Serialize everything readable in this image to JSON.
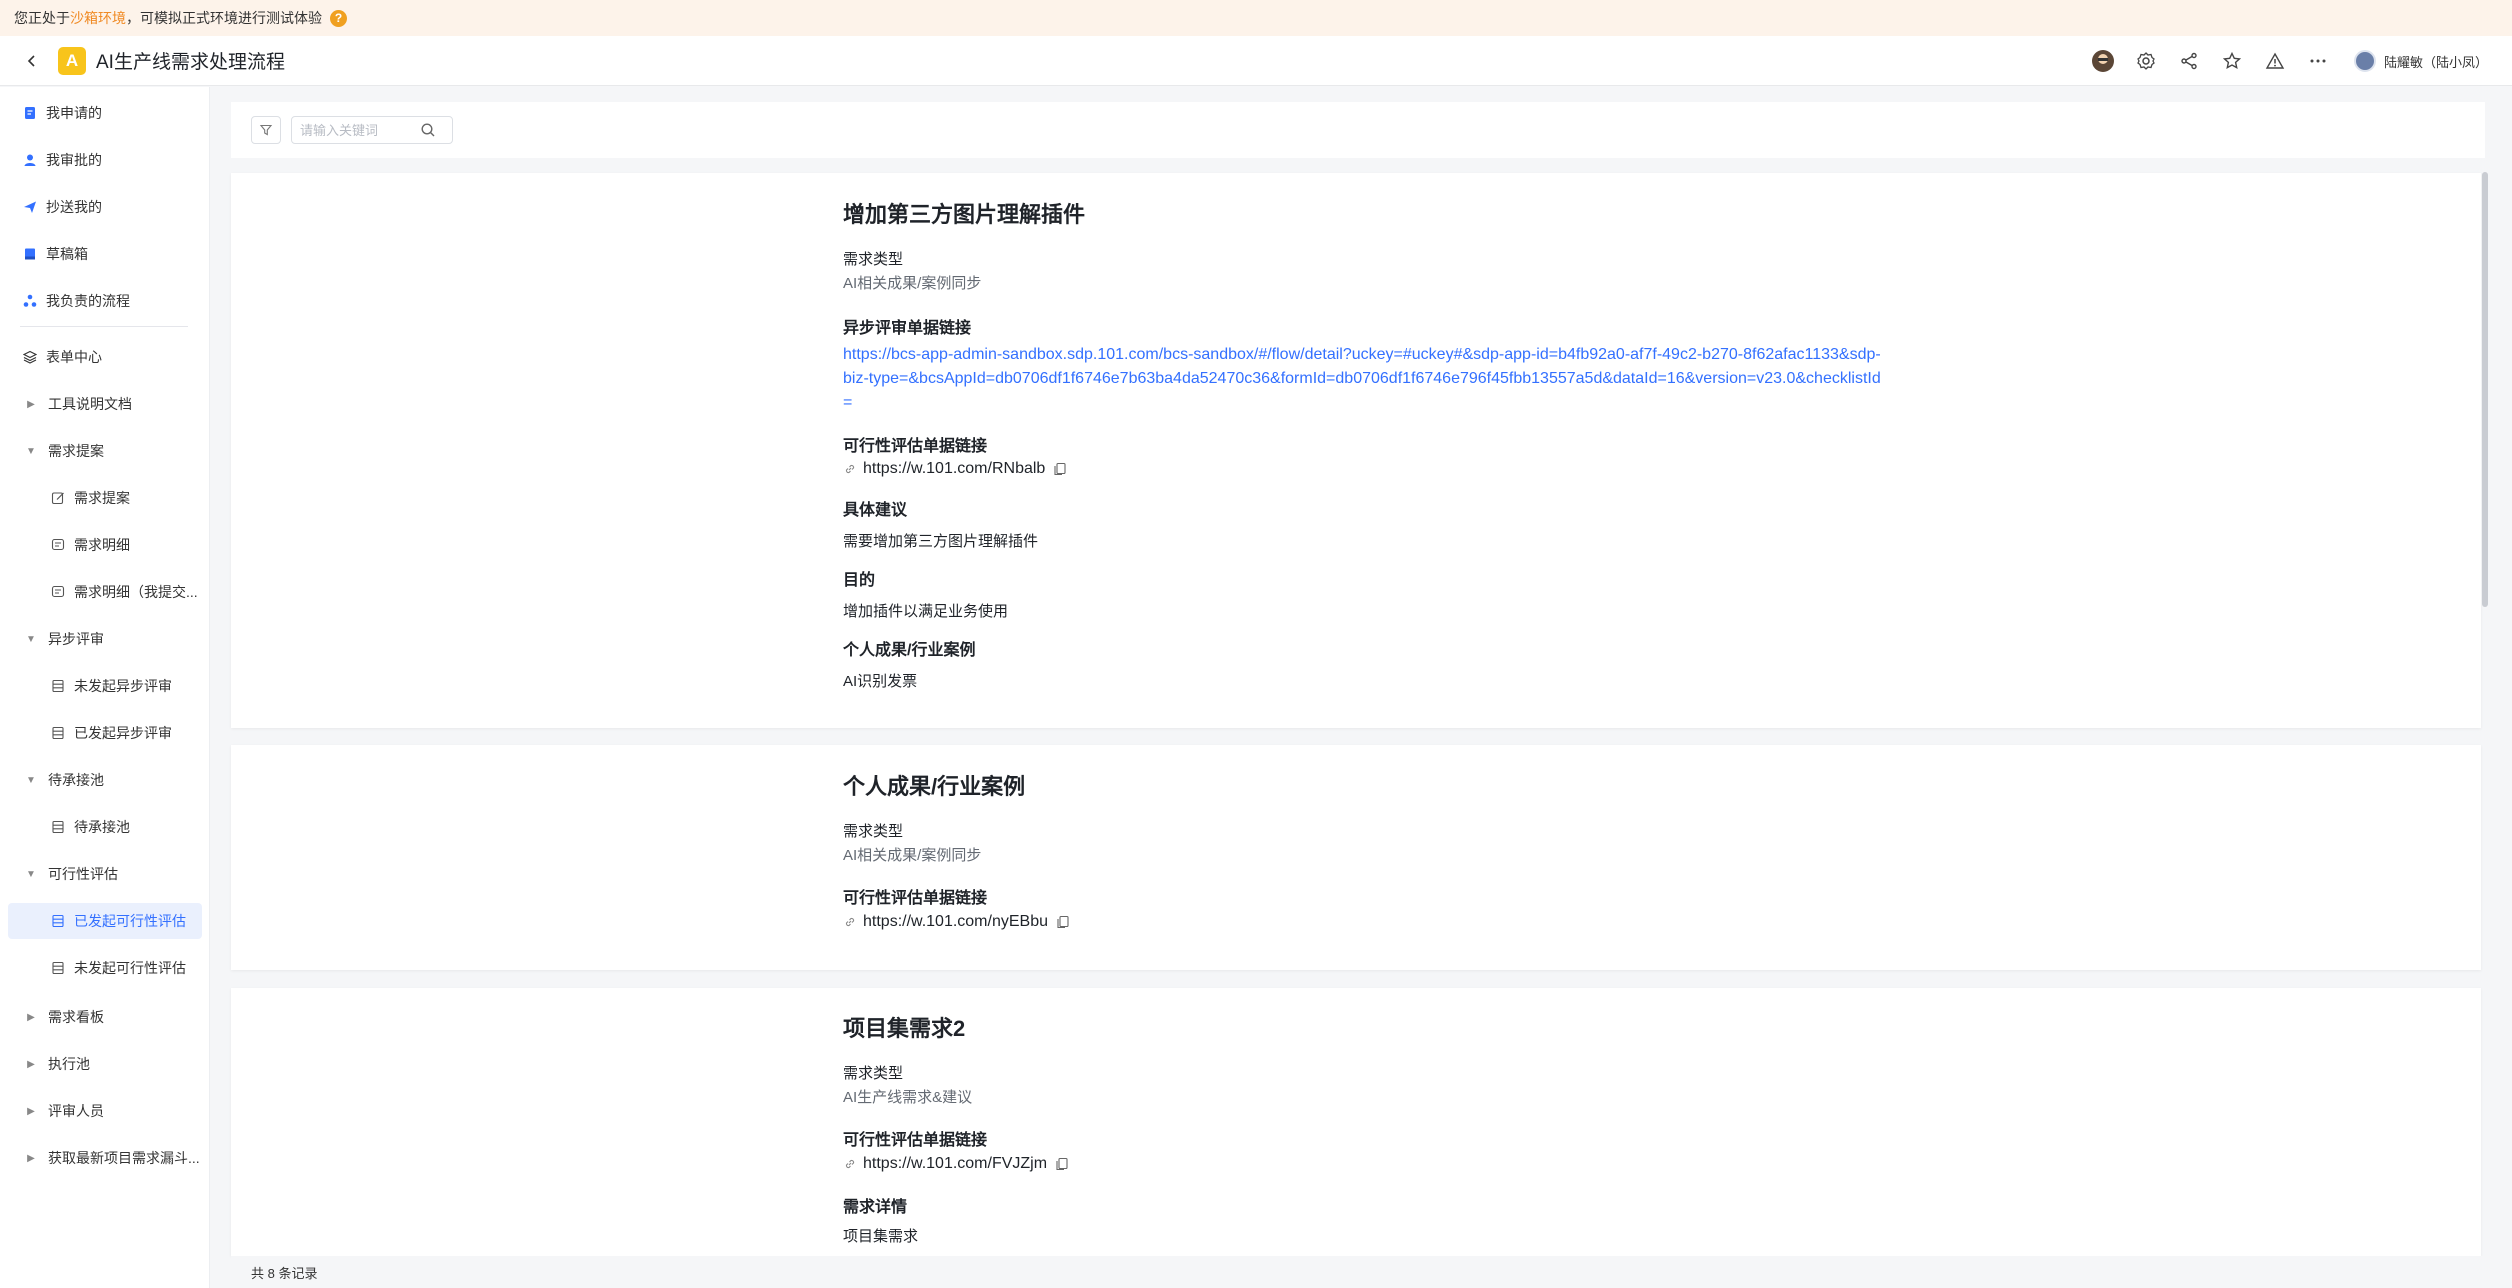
{
  "banner": {
    "prefix": "您正处于",
    "highlight": "沙箱环境",
    "suffix": "，可模拟正式环境进行测试体验",
    "help": "?"
  },
  "header": {
    "app_logo": "A",
    "title": "AI生产线需求处理流程",
    "user_name": "陆耀敏（陆小凤）"
  },
  "sidebar": {
    "items": [
      {
        "label": "我申请的",
        "icon": "file-icon"
      },
      {
        "label": "我审批的",
        "icon": "user-icon"
      },
      {
        "label": "抄送我的",
        "icon": "send-icon"
      },
      {
        "label": "草稿箱",
        "icon": "draft-icon"
      },
      {
        "label": "我负责的流程",
        "icon": "flow-icon"
      },
      {
        "label": "表单中心",
        "icon": "layers-icon"
      },
      {
        "label": "工具说明文档"
      },
      {
        "label": "需求提案"
      },
      {
        "label": "需求提案",
        "icon": "edit-icon"
      },
      {
        "label": "需求明细",
        "icon": "list-icon"
      },
      {
        "label": "需求明细（我提交...",
        "icon": "list-icon"
      },
      {
        "label": "异步评审"
      },
      {
        "label": "未发起异步评审",
        "icon": "table-icon"
      },
      {
        "label": "已发起异步评审",
        "icon": "table-icon"
      },
      {
        "label": "待承接池"
      },
      {
        "label": "待承接池",
        "icon": "table-icon"
      },
      {
        "label": "可行性评估"
      },
      {
        "label": "已发起可行性评估",
        "icon": "table-icon"
      },
      {
        "label": "未发起可行性评估",
        "icon": "table-icon"
      },
      {
        "label": "需求看板"
      },
      {
        "label": "执行池"
      },
      {
        "label": "评审人员"
      },
      {
        "label": "获取最新项目需求漏斗..."
      }
    ]
  },
  "search": {
    "placeholder": "请输入关键词"
  },
  "cards": [
    {
      "title": "增加第三方图片理解插件",
      "type_label": "需求类型",
      "type_value": "AI相关成果/案例同步",
      "async_label": "异步评审单据链接",
      "async_url": "https://bcs-app-admin-sandbox.sdp.101.com/bcs-sandbox/#/flow/detail?uckey=#uckey#&sdp-app-id=b4fb92a0-af7f-49c2-b270-8f62afac1133&sdp-biz-type=&bcsAppId=db0706df1f6746e7b63ba4da52470c36&formId=db0706df1f6746e796f45fbb13557a5d&dataId=16&version=v23.0&checklistId=",
      "feas_label": "可行性评估单据链接",
      "feas_url": "https://w.101.com/RNbalb",
      "advice_label": "具体建议",
      "advice_value": "需要增加第三方图片理解插件",
      "goal_label": "目的",
      "goal_value": "增加插件以满足业务使用",
      "case_label": "个人成果/行业案例",
      "case_value": "AI识别发票"
    },
    {
      "title": "个人成果/行业案例",
      "type_label": "需求类型",
      "type_value": "AI相关成果/案例同步",
      "feas_label": "可行性评估单据链接",
      "feas_url": "https://w.101.com/nyEBbu"
    },
    {
      "title": "项目集需求2",
      "type_label": "需求类型",
      "type_value": "AI生产线需求&建议",
      "feas_label": "可行性评估单据链接",
      "feas_url": "https://w.101.com/FVJZjm",
      "detail_label": "需求详情",
      "detail_value": "项目集需求"
    }
  ],
  "footer": {
    "total": "共 8 条记录"
  },
  "colors": {
    "accent": "#3370ff",
    "banner_bg": "#fdf3ea",
    "banner_highlight": "#f08a24",
    "logo": "#f8c41b"
  }
}
